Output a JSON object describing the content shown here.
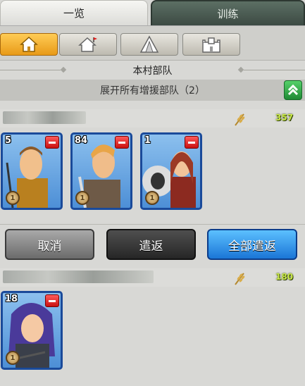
{
  "tabs": {
    "overview": "一览",
    "training": "训练"
  },
  "filter_tabs": [
    {
      "icon": "house-icon",
      "active": true
    },
    {
      "icon": "house-flag-icon",
      "active": false
    },
    {
      "icon": "tent-icon",
      "active": false
    },
    {
      "icon": "castle-icon",
      "active": false
    }
  ],
  "section": {
    "title": "本村部队"
  },
  "expand": {
    "label": "展开所有增援部队（2）"
  },
  "groups": [
    {
      "resource_icon": "wheat-icon",
      "count": "357",
      "units": [
        {
          "level": "5",
          "rank": "1"
        },
        {
          "level": "84",
          "rank": "1"
        },
        {
          "level": "1",
          "rank": "1"
        }
      ]
    },
    {
      "resource_icon": "wheat-icon",
      "count": "180",
      "units": [
        {
          "level": "18",
          "rank": "1"
        }
      ]
    }
  ],
  "buttons": {
    "cancel": "取消",
    "return": "遣返",
    "return_all": "全部遣返"
  },
  "colors": {
    "active_tab": "#f0a92b",
    "return_all": "#1b76d6",
    "count_text": "#c9e84a"
  }
}
